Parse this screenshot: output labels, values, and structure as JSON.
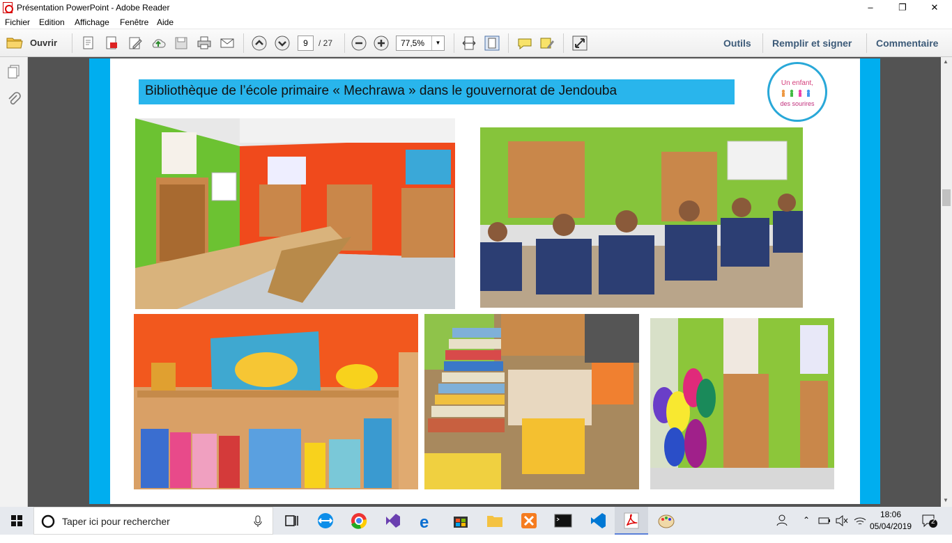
{
  "window": {
    "title": "Présentation PowerPoint - Adobe Reader"
  },
  "menu": [
    "Fichier",
    "Edition",
    "Affichage",
    "Fenêtre",
    "Aide"
  ],
  "toolbar": {
    "open_label": "Ouvrir",
    "page_current": "9",
    "page_total": "/ 27",
    "zoom": "77,5%",
    "tools_label": "Outils",
    "fill_sign_label": "Remplir et signer",
    "comment_label": "Commentaire"
  },
  "slide": {
    "heading": "Bibliothèque de l’école primaire « Mechrawa » dans le gouvernorat de Jendouba",
    "logo_line1": "Un enfant,",
    "logo_line2": "des sourires"
  },
  "taskbar": {
    "search_placeholder": "Taper ici pour rechercher",
    "time": "18:06",
    "date": "05/04/2019",
    "notifications": "2"
  },
  "colors": {
    "slide_border": "#00aeef",
    "heading_bg": "#29b5ec",
    "viewer_bg": "#535353"
  }
}
